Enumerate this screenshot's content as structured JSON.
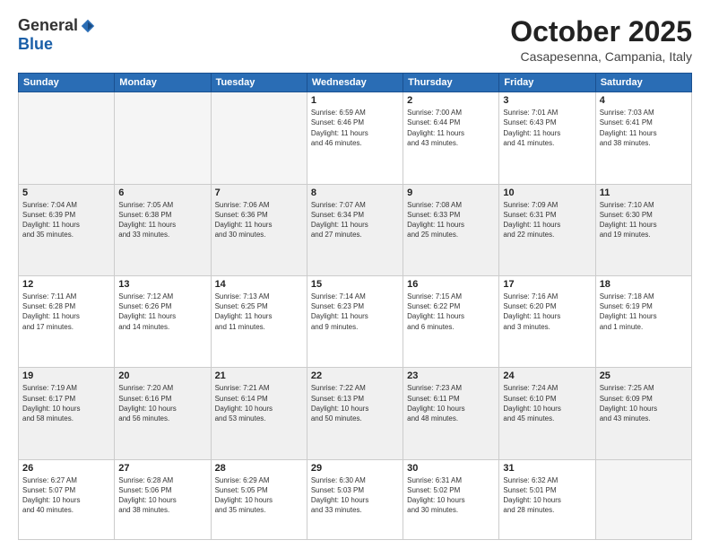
{
  "logo": {
    "general": "General",
    "blue": "Blue"
  },
  "title": "October 2025",
  "subtitle": "Casapesenna, Campania, Italy",
  "days_of_week": [
    "Sunday",
    "Monday",
    "Tuesday",
    "Wednesday",
    "Thursday",
    "Friday",
    "Saturday"
  ],
  "weeks": [
    [
      {
        "day": "",
        "info": "",
        "empty": true
      },
      {
        "day": "",
        "info": "",
        "empty": true
      },
      {
        "day": "",
        "info": "",
        "empty": true
      },
      {
        "day": "1",
        "info": "Sunrise: 6:59 AM\nSunset: 6:46 PM\nDaylight: 11 hours\nand 46 minutes.",
        "empty": false
      },
      {
        "day": "2",
        "info": "Sunrise: 7:00 AM\nSunset: 6:44 PM\nDaylight: 11 hours\nand 43 minutes.",
        "empty": false
      },
      {
        "day": "3",
        "info": "Sunrise: 7:01 AM\nSunset: 6:43 PM\nDaylight: 11 hours\nand 41 minutes.",
        "empty": false
      },
      {
        "day": "4",
        "info": "Sunrise: 7:03 AM\nSunset: 6:41 PM\nDaylight: 11 hours\nand 38 minutes.",
        "empty": false
      }
    ],
    [
      {
        "day": "5",
        "info": "Sunrise: 7:04 AM\nSunset: 6:39 PM\nDaylight: 11 hours\nand 35 minutes.",
        "empty": false
      },
      {
        "day": "6",
        "info": "Sunrise: 7:05 AM\nSunset: 6:38 PM\nDaylight: 11 hours\nand 33 minutes.",
        "empty": false
      },
      {
        "day": "7",
        "info": "Sunrise: 7:06 AM\nSunset: 6:36 PM\nDaylight: 11 hours\nand 30 minutes.",
        "empty": false
      },
      {
        "day": "8",
        "info": "Sunrise: 7:07 AM\nSunset: 6:34 PM\nDaylight: 11 hours\nand 27 minutes.",
        "empty": false
      },
      {
        "day": "9",
        "info": "Sunrise: 7:08 AM\nSunset: 6:33 PM\nDaylight: 11 hours\nand 25 minutes.",
        "empty": false
      },
      {
        "day": "10",
        "info": "Sunrise: 7:09 AM\nSunset: 6:31 PM\nDaylight: 11 hours\nand 22 minutes.",
        "empty": false
      },
      {
        "day": "11",
        "info": "Sunrise: 7:10 AM\nSunset: 6:30 PM\nDaylight: 11 hours\nand 19 minutes.",
        "empty": false
      }
    ],
    [
      {
        "day": "12",
        "info": "Sunrise: 7:11 AM\nSunset: 6:28 PM\nDaylight: 11 hours\nand 17 minutes.",
        "empty": false
      },
      {
        "day": "13",
        "info": "Sunrise: 7:12 AM\nSunset: 6:26 PM\nDaylight: 11 hours\nand 14 minutes.",
        "empty": false
      },
      {
        "day": "14",
        "info": "Sunrise: 7:13 AM\nSunset: 6:25 PM\nDaylight: 11 hours\nand 11 minutes.",
        "empty": false
      },
      {
        "day": "15",
        "info": "Sunrise: 7:14 AM\nSunset: 6:23 PM\nDaylight: 11 hours\nand 9 minutes.",
        "empty": false
      },
      {
        "day": "16",
        "info": "Sunrise: 7:15 AM\nSunset: 6:22 PM\nDaylight: 11 hours\nand 6 minutes.",
        "empty": false
      },
      {
        "day": "17",
        "info": "Sunrise: 7:16 AM\nSunset: 6:20 PM\nDaylight: 11 hours\nand 3 minutes.",
        "empty": false
      },
      {
        "day": "18",
        "info": "Sunrise: 7:18 AM\nSunset: 6:19 PM\nDaylight: 11 hours\nand 1 minute.",
        "empty": false
      }
    ],
    [
      {
        "day": "19",
        "info": "Sunrise: 7:19 AM\nSunset: 6:17 PM\nDaylight: 10 hours\nand 58 minutes.",
        "empty": false
      },
      {
        "day": "20",
        "info": "Sunrise: 7:20 AM\nSunset: 6:16 PM\nDaylight: 10 hours\nand 56 minutes.",
        "empty": false
      },
      {
        "day": "21",
        "info": "Sunrise: 7:21 AM\nSunset: 6:14 PM\nDaylight: 10 hours\nand 53 minutes.",
        "empty": false
      },
      {
        "day": "22",
        "info": "Sunrise: 7:22 AM\nSunset: 6:13 PM\nDaylight: 10 hours\nand 50 minutes.",
        "empty": false
      },
      {
        "day": "23",
        "info": "Sunrise: 7:23 AM\nSunset: 6:11 PM\nDaylight: 10 hours\nand 48 minutes.",
        "empty": false
      },
      {
        "day": "24",
        "info": "Sunrise: 7:24 AM\nSunset: 6:10 PM\nDaylight: 10 hours\nand 45 minutes.",
        "empty": false
      },
      {
        "day": "25",
        "info": "Sunrise: 7:25 AM\nSunset: 6:09 PM\nDaylight: 10 hours\nand 43 minutes.",
        "empty": false
      }
    ],
    [
      {
        "day": "26",
        "info": "Sunrise: 6:27 AM\nSunset: 5:07 PM\nDaylight: 10 hours\nand 40 minutes.",
        "empty": false
      },
      {
        "day": "27",
        "info": "Sunrise: 6:28 AM\nSunset: 5:06 PM\nDaylight: 10 hours\nand 38 minutes.",
        "empty": false
      },
      {
        "day": "28",
        "info": "Sunrise: 6:29 AM\nSunset: 5:05 PM\nDaylight: 10 hours\nand 35 minutes.",
        "empty": false
      },
      {
        "day": "29",
        "info": "Sunrise: 6:30 AM\nSunset: 5:03 PM\nDaylight: 10 hours\nand 33 minutes.",
        "empty": false
      },
      {
        "day": "30",
        "info": "Sunrise: 6:31 AM\nSunset: 5:02 PM\nDaylight: 10 hours\nand 30 minutes.",
        "empty": false
      },
      {
        "day": "31",
        "info": "Sunrise: 6:32 AM\nSunset: 5:01 PM\nDaylight: 10 hours\nand 28 minutes.",
        "empty": false
      },
      {
        "day": "",
        "info": "",
        "empty": true
      }
    ]
  ]
}
